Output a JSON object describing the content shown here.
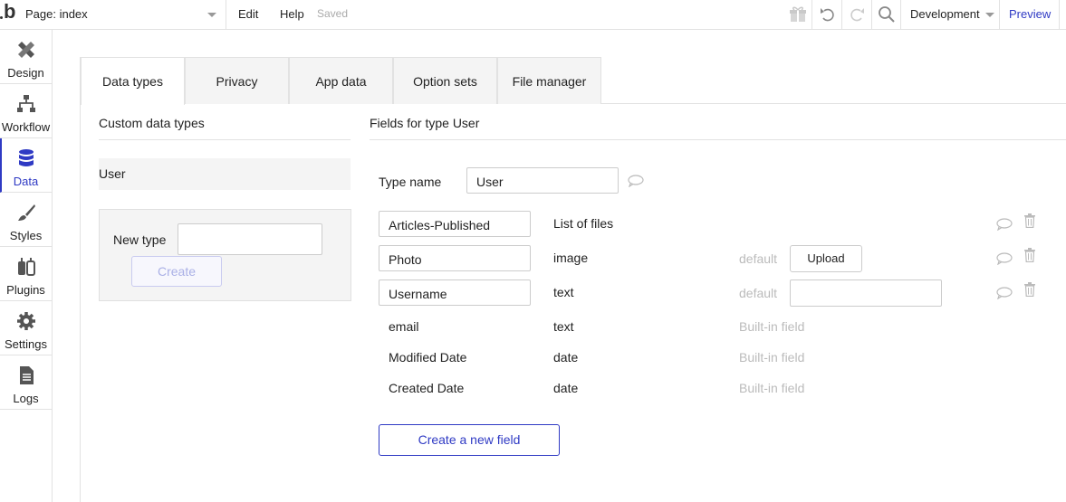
{
  "topbar": {
    "page_label": "Page: index",
    "menu": [
      "Edit",
      "Help"
    ],
    "status": "Saved",
    "environment": "Development",
    "preview": "Preview"
  },
  "sidebar": {
    "items": [
      {
        "label": "Design",
        "icon": "design-icon"
      },
      {
        "label": "Workflow",
        "icon": "workflow-icon"
      },
      {
        "label": "Data",
        "icon": "database-icon",
        "active": true
      },
      {
        "label": "Styles",
        "icon": "brush-icon"
      },
      {
        "label": "Plugins",
        "icon": "plug-icon"
      },
      {
        "label": "Settings",
        "icon": "gear-icon"
      },
      {
        "label": "Logs",
        "icon": "document-icon"
      }
    ]
  },
  "tabs": [
    {
      "label": "Data types",
      "active": true
    },
    {
      "label": "Privacy"
    },
    {
      "label": "App data"
    },
    {
      "label": "Option sets"
    },
    {
      "label": "File manager"
    }
  ],
  "left": {
    "title": "Custom data types",
    "types": [
      "User"
    ],
    "new_type_label": "New type",
    "new_type_value": "",
    "create_label": "Create"
  },
  "right": {
    "title": "Fields for type User",
    "type_name_label": "Type name",
    "type_name_value": "User",
    "fields": [
      {
        "name": "Articles-Published",
        "type": "List of files",
        "editable": true
      },
      {
        "name": "Photo",
        "type": "image",
        "editable": true,
        "default_label": "default",
        "default_control": "Upload"
      },
      {
        "name": "Username",
        "type": "text",
        "editable": true,
        "default_label": "default"
      },
      {
        "name": "email",
        "type": "text",
        "builtin": "Built-in field"
      },
      {
        "name": "Modified Date",
        "type": "date",
        "builtin": "Built-in field"
      },
      {
        "name": "Created Date",
        "type": "date",
        "builtin": "Built-in field"
      }
    ],
    "new_field_label": "Create a new field"
  },
  "colors": {
    "accent": "#2f3ac4",
    "muted": "#bbbbbb",
    "panel_bg": "#f4f4f4",
    "border": "#e2e2e2"
  }
}
